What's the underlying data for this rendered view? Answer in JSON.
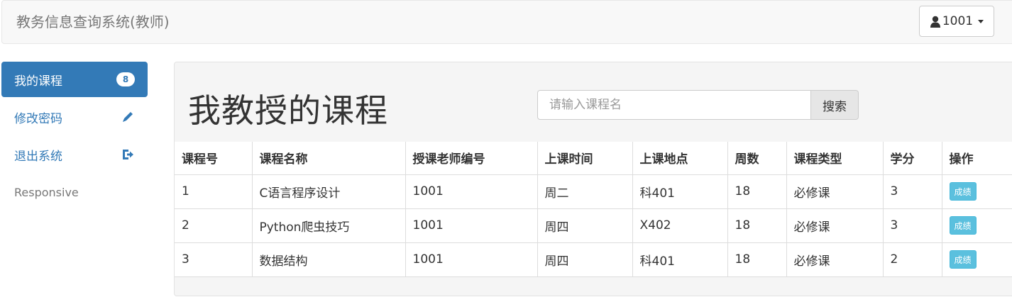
{
  "header": {
    "brand": "教务信息查询系统(教师)",
    "user_label": "1001"
  },
  "sidebar": {
    "items": [
      {
        "label": "我的课程",
        "badge": "8",
        "icon": "none"
      },
      {
        "label": "修改密码",
        "icon": "pencil-icon"
      },
      {
        "label": "退出系统",
        "icon": "logout-icon"
      },
      {
        "label": "Responsive"
      }
    ]
  },
  "main": {
    "title": "我教授的课程",
    "search": {
      "placeholder": "请输入课程名",
      "value": "",
      "button_label": "搜索"
    }
  },
  "table": {
    "columns": [
      "课程号",
      "课程名称",
      "授课老师编号",
      "上课时间",
      "上课地点",
      "周数",
      "课程类型",
      "学分",
      "操作"
    ],
    "rows": [
      {
        "id": "1",
        "name": "C语言程序设计",
        "teacher": "1001",
        "time": "周二",
        "location": "科401",
        "weeks": "18",
        "type": "必修课",
        "credit": "3",
        "action": "成绩"
      },
      {
        "id": "2",
        "name": "Python爬虫技巧",
        "teacher": "1001",
        "time": "周四",
        "location": "X402",
        "weeks": "18",
        "type": "必修课",
        "credit": "3",
        "action": "成绩"
      },
      {
        "id": "3",
        "name": "数据结构",
        "teacher": "1001",
        "time": "周四",
        "location": "科401",
        "weeks": "18",
        "type": "必修课",
        "credit": "2",
        "action": "成绩"
      }
    ]
  },
  "colors": {
    "primary": "#337ab7",
    "info": "#5bc0de",
    "navbar_bg": "#f8f8f8",
    "panel_bg": "#f5f5f5"
  }
}
